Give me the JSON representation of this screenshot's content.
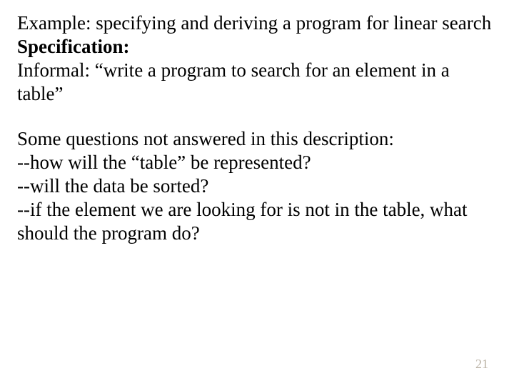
{
  "block1": {
    "line1": "Example: specifying and deriving a program for linear search",
    "spec_label": "Specification:",
    "informal": "Informal:  “write a program to search for an element in a table”"
  },
  "block2": {
    "intro": "Some questions not answered in this description:",
    "q1": "--how will the “table” be represented?",
    "q2": "--will the data be sorted?",
    "q3": "--if the element we are looking for is not in the table, what should the program do?"
  },
  "page_number": "21"
}
